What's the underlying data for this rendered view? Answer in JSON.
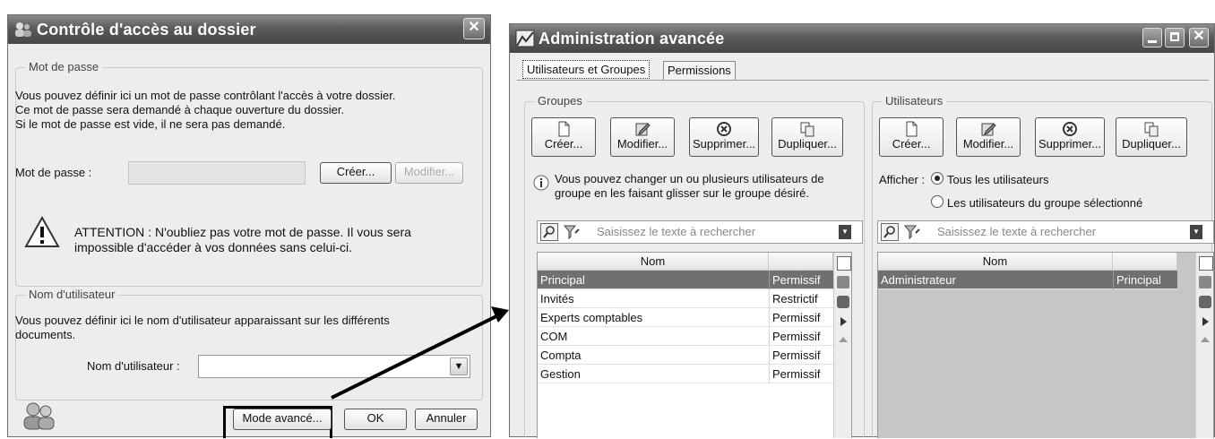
{
  "left_dialog": {
    "title": "Contrôle d'accès au dossier",
    "close_glyph": "✕",
    "password_group": {
      "legend": "Mot de passe",
      "desc_line1": "Vous pouvez définir ici un mot de passe contrôlant l'accès à votre dossier.",
      "desc_line2": "Ce mot de passe sera demandé à chaque ouverture du dossier.",
      "desc_line3": "Si le mot de passe est vide, il ne sera pas demandé.",
      "field_label": "Mot de passe :",
      "field_value": "",
      "create_button": "Créer...",
      "modify_button": "Modifier...",
      "warning_line1": "ATTENTION : N'oubliez pas votre mot de passe. Il vous sera",
      "warning_line2": "impossible d'accéder à vos données sans celui-ci."
    },
    "username_group": {
      "legend": "Nom d'utilisateur",
      "desc_line1": "Vous pouvez définir ici le nom d'utilisateur apparaissant sur les différents",
      "desc_line2": "documents.",
      "field_label": "Nom d'utilisateur :",
      "field_value": ""
    },
    "footer": {
      "advanced_button": "Mode avancé...",
      "ok_button": "OK",
      "cancel_button": "Annuler"
    }
  },
  "right_window": {
    "title": "Administration avancée",
    "tabs": [
      "Utilisateurs et Groupes",
      "Permissions"
    ],
    "active_tab": "Utilisateurs et Groupes",
    "groups_panel": {
      "legend": "Groupes",
      "buttons": [
        "Créer...",
        "Modifier...",
        "Supprimer...",
        "Dupliquer..."
      ],
      "info_line1": "Vous pouvez changer un ou plusieurs utilisateurs de",
      "info_line2": "groupe en les faisant glisser sur le groupe désiré.",
      "search_placeholder": "Saisissez le texte à rechercher",
      "column_header": "Nom",
      "rows": [
        {
          "name": "Principal",
          "perm": "Permissif",
          "selected": true
        },
        {
          "name": "Invités",
          "perm": "Restrictif",
          "selected": false
        },
        {
          "name": "Experts comptables",
          "perm": "Permissif",
          "selected": false
        },
        {
          "name": "COM",
          "perm": "Permissif",
          "selected": false
        },
        {
          "name": "Compta",
          "perm": "Permissif",
          "selected": false
        },
        {
          "name": "Gestion",
          "perm": "Permissif",
          "selected": false
        }
      ]
    },
    "users_panel": {
      "legend": "Utilisateurs",
      "buttons": [
        "Créer...",
        "Modifier...",
        "Supprimer...",
        "Dupliquer..."
      ],
      "show_label": "Afficher :",
      "radio_all": "Tous les utilisateurs",
      "radio_group": "Les utilisateurs du groupe sélectionné",
      "radio_selected": "all",
      "search_placeholder": "Saisissez le texte à rechercher",
      "column_header": "Nom",
      "rows": [
        {
          "name": "Administrateur",
          "group": "Principal",
          "selected": true
        }
      ]
    }
  },
  "colors": {
    "titlebar": "#5a5a5a",
    "selected_row": "#707070",
    "dialog_bg": "#ededed"
  }
}
